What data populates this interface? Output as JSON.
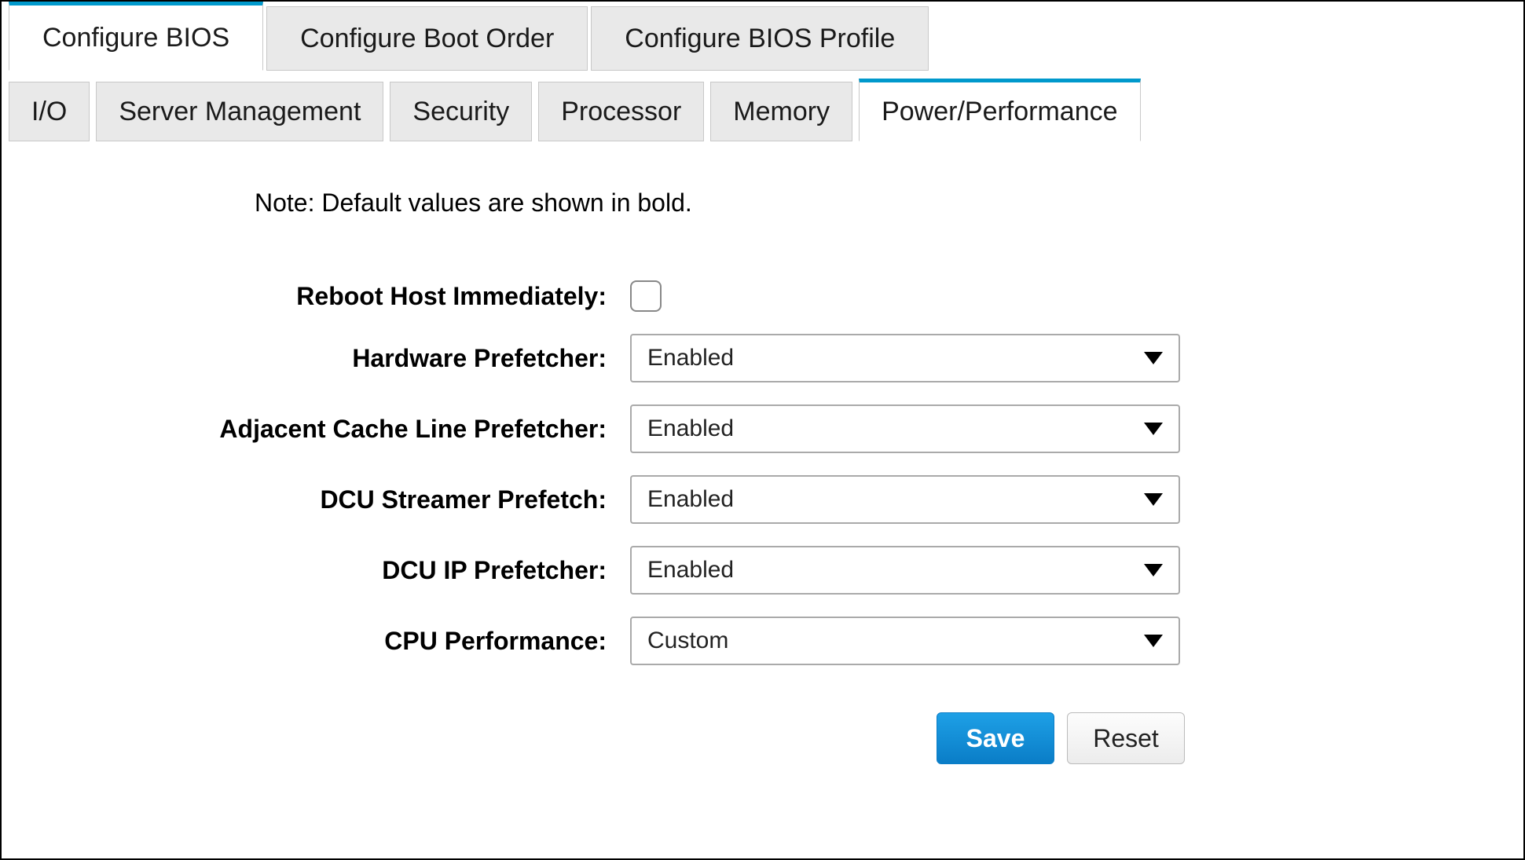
{
  "top_tabs": {
    "t0": "Configure BIOS",
    "t1": "Configure Boot Order",
    "t2": "Configure BIOS Profile",
    "active_index": 0
  },
  "sub_tabs": {
    "s0": "I/O",
    "s1": "Server Management",
    "s2": "Security",
    "s3": "Processor",
    "s4": "Memory",
    "s5": "Power/Performance",
    "active_index": 5
  },
  "note": "Note: Default values are shown in bold.",
  "form": {
    "reboot_label": "Reboot Host Immediately:",
    "reboot_checked": false,
    "hw_prefetch_label": "Hardware Prefetcher:",
    "hw_prefetch_value": "Enabled",
    "adj_cache_label": "Adjacent Cache Line Prefetcher:",
    "adj_cache_value": "Enabled",
    "dcu_streamer_label": "DCU Streamer Prefetch:",
    "dcu_streamer_value": "Enabled",
    "dcu_ip_label": "DCU IP Prefetcher:",
    "dcu_ip_value": "Enabled",
    "cpu_perf_label": "CPU Performance:",
    "cpu_perf_value": "Custom"
  },
  "buttons": {
    "save": "Save",
    "reset": "Reset"
  }
}
